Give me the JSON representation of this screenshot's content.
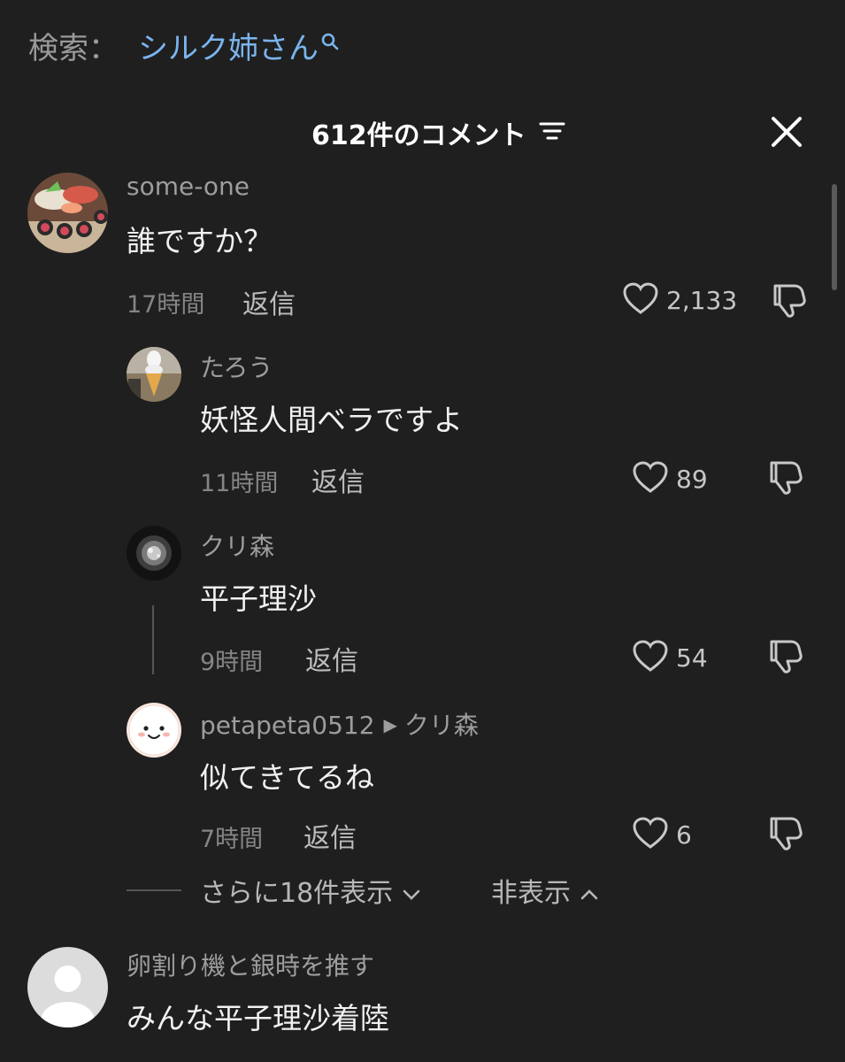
{
  "search": {
    "label": "検索：",
    "term": "シルク姉さん"
  },
  "header": {
    "title": "612件のコメント"
  },
  "comments": [
    {
      "user": "some-one",
      "text": "誰ですか？",
      "time": "17時間",
      "reply": "返信",
      "likes": "2,133"
    },
    {
      "user": "たろう",
      "text": "妖怪人間ベラですよ",
      "time": "11時間",
      "reply": "返信",
      "likes": "89"
    },
    {
      "user": "クリ森",
      "text": "平子理沙",
      "time": "9時間",
      "reply": "返信",
      "likes": "54"
    },
    {
      "user": "petapeta0512",
      "reply_to": "クリ森",
      "text": "似てきてるね",
      "time": "7時間",
      "reply": "返信",
      "likes": "6"
    },
    {
      "user": "卵割り機と銀時を推す",
      "text": "みんな平子理沙着陸"
    }
  ],
  "thread": {
    "show_more": "さらに18件表示",
    "hide": "非表示"
  },
  "colors": {
    "background": "#1f1f1f",
    "search_term": "#7ab4ee",
    "secondary_text": "#9d9d9d"
  }
}
